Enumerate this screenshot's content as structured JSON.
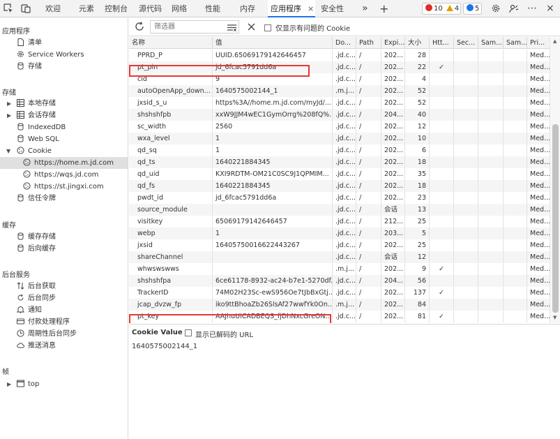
{
  "top_tabs": [
    "欢迎",
    "元素",
    "控制台",
    "源代码",
    "网络",
    "性能",
    "内存",
    "应用程序",
    "安全性"
  ],
  "close_glyph": "×",
  "more_glyph": "»",
  "add_glyph": "+",
  "badges": {
    "errors": "10",
    "warnings": "4",
    "info": "5"
  },
  "badge_colors": {
    "error": "#d93025",
    "warning": "#e0a000",
    "info": "#1a73e8"
  },
  "menu_glyph": "⋯",
  "sidebar": {
    "app_header": "应用程序",
    "app_items": [
      "清单",
      "Service Workers",
      "存储"
    ],
    "storage_header": "存储",
    "storage_items": [
      "本地存储",
      "会话存储",
      "IndexedDB",
      "Web SQL",
      "Cookie"
    ],
    "cookie_origins": [
      "https://home.m.jd.com",
      "https://wqs.jd.com",
      "https://st.jingxi.com"
    ],
    "trust_tokens": "信任令牌",
    "cache_header": "缓存",
    "cache_items": [
      "缓存存储",
      "后向缓存"
    ],
    "bg_header": "后台服务",
    "bg_items": [
      "后台获取",
      "后台同步",
      "通知",
      "付款处理程序",
      "周期性后台同步",
      "推送消息"
    ],
    "frames_header": "帧",
    "frames_items": [
      "top"
    ]
  },
  "toolbar": {
    "filter_placeholder": "筛选器",
    "only_issues_label": "仅显示有问题的 Cookie"
  },
  "table": {
    "headers": [
      "名称",
      "值",
      "Do...",
      "Path",
      "Expi...",
      "大小",
      "Htt...",
      "Sec...",
      "Sam...",
      "Sam...",
      "Pri..."
    ],
    "rows": [
      [
        "PPRD_P",
        "UUID.65069179142646457",
        ".jd.c...",
        "/",
        "202...",
        "28",
        "",
        "",
        "",
        "",
        "Med..."
      ],
      [
        "pt_pin",
        "jd_6fcac5791dd6a",
        ".jd.c...",
        "/",
        "202...",
        "22",
        "✓",
        "",
        "",
        "",
        "Med..."
      ],
      [
        "cid",
        "9",
        ".jd.c...",
        "/",
        "202...",
        "4",
        "",
        "",
        "",
        "",
        "Med..."
      ],
      [
        "autoOpenApp_down...",
        "1640575002144_1",
        ".m.j...",
        "/",
        "202...",
        "52",
        "",
        "",
        "",
        "",
        "Med..."
      ],
      [
        "jxsid_s_u",
        "https%3A//home.m.jd.com/myJd/...",
        ".jd.c...",
        "/",
        "202...",
        "52",
        "",
        "",
        "",
        "",
        "Med..."
      ],
      [
        "shshshfpb",
        "xxW9JJM4wEC1GymOrrg%208fQ%...",
        ".jd.c...",
        "/",
        "204...",
        "40",
        "",
        "",
        "",
        "",
        "Med..."
      ],
      [
        "sc_width",
        "2560",
        ".jd.c...",
        "/",
        "202...",
        "12",
        "",
        "",
        "",
        "",
        "Med..."
      ],
      [
        "wxa_level",
        "1",
        ".jd.c...",
        "/",
        "202...",
        "10",
        "",
        "",
        "",
        "",
        "Med..."
      ],
      [
        "qd_sq",
        "1",
        ".jd.c...",
        "/",
        "202...",
        "6",
        "",
        "",
        "",
        "",
        "Med..."
      ],
      [
        "qd_ts",
        "1640221884345",
        ".jd.c...",
        "/",
        "202...",
        "18",
        "",
        "",
        "",
        "",
        "Med..."
      ],
      [
        "qd_uid",
        "KXI9RDTM-OM21C0SC9J1QPMIM...",
        ".jd.c...",
        "/",
        "202...",
        "35",
        "",
        "",
        "",
        "",
        "Med..."
      ],
      [
        "qd_fs",
        "1640221884345",
        ".jd.c...",
        "/",
        "202...",
        "18",
        "",
        "",
        "",
        "",
        "Med..."
      ],
      [
        "pwdt_id",
        "jd_6fcac5791dd6a",
        ".jd.c...",
        "/",
        "202...",
        "23",
        "",
        "",
        "",
        "",
        "Med..."
      ],
      [
        "source_module",
        "",
        ".jd.c...",
        "/",
        "会话",
        "13",
        "",
        "",
        "",
        "",
        "Med..."
      ],
      [
        "visitkey",
        "65069179142646457",
        ".jd.c...",
        "/",
        "212...",
        "25",
        "",
        "",
        "",
        "",
        "Med..."
      ],
      [
        "webp",
        "1",
        ".jd.c...",
        "/",
        "203...",
        "5",
        "",
        "",
        "",
        "",
        "Med..."
      ],
      [
        "jxsid",
        "16405750016622443267",
        ".jd.c...",
        "/",
        "202...",
        "25",
        "",
        "",
        "",
        "",
        "Med..."
      ],
      [
        "shareChannel",
        "",
        ".jd.c...",
        "/",
        "会话",
        "12",
        "",
        "",
        "",
        "",
        "Med..."
      ],
      [
        "whwswswws",
        "",
        ".m.j...",
        "/",
        "202...",
        "9",
        "✓",
        "",
        "",
        "",
        "Med..."
      ],
      [
        "shshshfpa",
        "6ce61178-8932-ac24-b7e1-5270df...",
        ".jd.c...",
        "/",
        "204...",
        "56",
        "",
        "",
        "",
        "",
        "Med..."
      ],
      [
        "TrackerID",
        "74M02H23Sc-ewS956Oe7tJbBxGtj...",
        ".jd.c...",
        "/",
        "202...",
        "137",
        "✓",
        "",
        "",
        "",
        "Med..."
      ],
      [
        "jcap_dvzw_fp",
        "iko9ttBhoaZb26SlsAf27wwfYk0On...",
        ".m.j...",
        "/",
        "202...",
        "84",
        "",
        "",
        "",
        "",
        "Med..."
      ],
      [
        "pt_key",
        "AAJhuUiCADBEQS_fjDhNxcGreON...",
        ".jd.c...",
        "/",
        "202...",
        "81",
        "✓",
        "",
        "",
        "",
        "Med..."
      ]
    ]
  },
  "cookie_value": {
    "label": "Cookie Value",
    "decode_label": "显示已解码的 URL",
    "value": "1640575002144_1"
  }
}
